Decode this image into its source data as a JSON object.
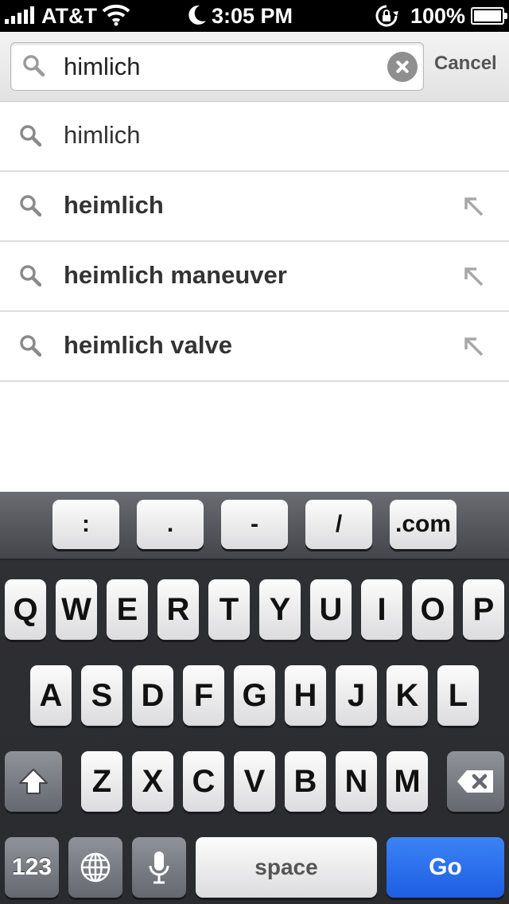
{
  "status_bar": {
    "carrier": "AT&T",
    "time": "3:05 PM",
    "battery": "100%"
  },
  "search": {
    "query": "himlich",
    "cancel_label": "Cancel"
  },
  "suggestions": [
    {
      "text": "himlich",
      "bold": false,
      "has_arrow": false
    },
    {
      "text": "heimlich",
      "bold": true,
      "has_arrow": true
    },
    {
      "text": "heimlich maneuver",
      "bold": true,
      "has_arrow": true
    },
    {
      "text": "heimlich valve",
      "bold": true,
      "has_arrow": true
    }
  ],
  "keyboard": {
    "top_row": [
      ":",
      ".",
      "-",
      "/",
      ".com"
    ],
    "row1": [
      "Q",
      "W",
      "E",
      "R",
      "T",
      "Y",
      "U",
      "I",
      "O",
      "P"
    ],
    "row2": [
      "A",
      "S",
      "D",
      "F",
      "G",
      "H",
      "J",
      "K",
      "L"
    ],
    "row3": [
      "Z",
      "X",
      "C",
      "V",
      "B",
      "N",
      "M"
    ],
    "numbers_label": "123",
    "space_label": "space",
    "go_label": "Go"
  },
  "colors": {
    "go_button": "#1e5ee3",
    "status_bar_bg": "#000000"
  }
}
